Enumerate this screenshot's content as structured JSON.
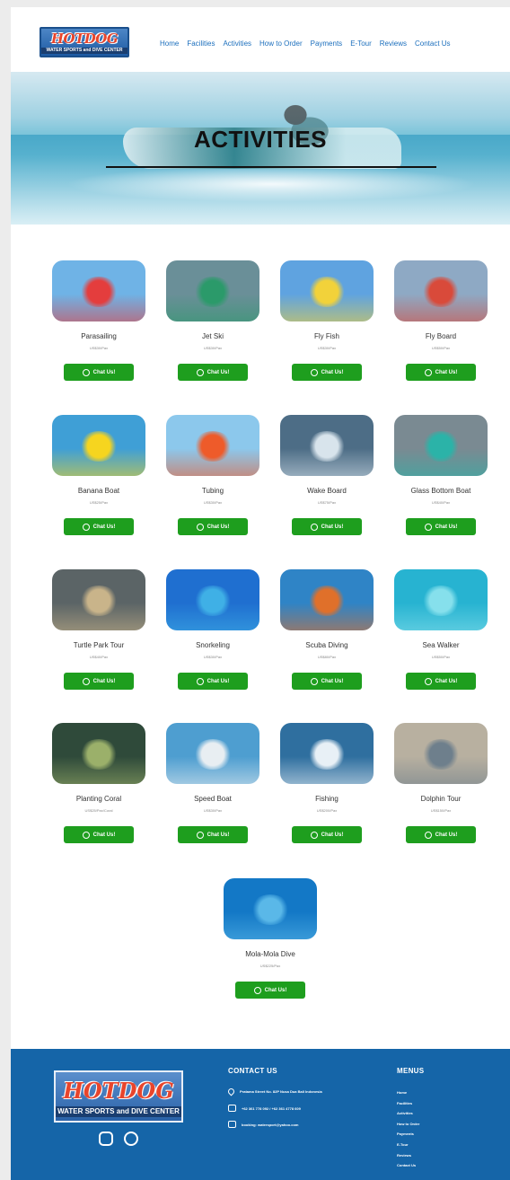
{
  "header": {
    "logo": {
      "title": "HOTDOG",
      "subtitle": "WATER SPORTS and DIVE CENTER"
    },
    "nav": [
      "Home",
      "Facilities",
      "Activities",
      "How to Order",
      "Payments",
      "E-Tour",
      "Reviews",
      "Contact Us"
    ]
  },
  "hero": {
    "title": "ACTIVITIES"
  },
  "activities": [
    {
      "name": "Parasailing",
      "price": "US$30/Pax",
      "button": "Chat Us!",
      "c1": "#6fb3e6",
      "c2": "#e43d3d"
    },
    {
      "name": "Jet Ski",
      "price": "US$30/Pax",
      "button": "Chat Us!",
      "c1": "#6a8f98",
      "c2": "#2b9a6a"
    },
    {
      "name": "Fly Fish",
      "price": "US$30/Pax",
      "button": "Chat Us!",
      "c1": "#5fa3e0",
      "c2": "#f2d23a"
    },
    {
      "name": "Fly Board",
      "price": "US$50/Pax",
      "button": "Chat Us!",
      "c1": "#8ea9c4",
      "c2": "#d94a3a"
    },
    {
      "name": "Banana Boat",
      "price": "US$25/Pax",
      "button": "Chat Us!",
      "c1": "#3f9fd6",
      "c2": "#f6d51f"
    },
    {
      "name": "Tubing",
      "price": "US$30/Pax",
      "button": "Chat Us!",
      "c1": "#8cc8ec",
      "c2": "#ee5b2a"
    },
    {
      "name": "Wake Board",
      "price": "US$75/Pax",
      "button": "Chat Us!",
      "c1": "#4d6d86",
      "c2": "#d8e4ec"
    },
    {
      "name": "Glass Bottom Boat",
      "price": "US$40/Pax",
      "button": "Chat Us!",
      "c1": "#7a8a92",
      "c2": "#2bb3a8"
    },
    {
      "name": "Turtle Park Tour",
      "price": "US$40/Pax",
      "button": "Chat Us!",
      "c1": "#5b6466",
      "c2": "#c9b48a"
    },
    {
      "name": "Snorkeling",
      "price": "US$30/Pax",
      "button": "Chat Us!",
      "c1": "#1f6fd0",
      "c2": "#3fb0e6"
    },
    {
      "name": "Scuba Diving",
      "price": "US$80/Pax",
      "button": "Chat Us!",
      "c1": "#2f84c6",
      "c2": "#e0702a"
    },
    {
      "name": "Sea Walker",
      "price": "US$50/Pax",
      "button": "Chat Us!",
      "c1": "#27b3d1",
      "c2": "#86e0ec"
    },
    {
      "name": "Planting Coral",
      "price": "US$25/Pax/Coral",
      "button": "Chat Us!",
      "c1": "#2f4a3a",
      "c2": "#9bb06a"
    },
    {
      "name": "Speed Boat",
      "price": "US$30/Pax",
      "button": "Chat Us!",
      "c1": "#4e9ed0",
      "c2": "#e8eef2"
    },
    {
      "name": "Fishing",
      "price": "US$200/Pax",
      "button": "Chat Us!",
      "c1": "#2f6f9f",
      "c2": "#e8f0f6"
    },
    {
      "name": "Dolphin Tour",
      "price": "US$150/Pax",
      "button": "Chat Us!",
      "c1": "#b8b0a0",
      "c2": "#6e7f8c"
    },
    {
      "name": "Mola-Mola Dive",
      "price": "US$225/Pax",
      "button": "Chat Us!",
      "c1": "#1378c6",
      "c2": "#5ab8e8"
    }
  ],
  "footer": {
    "logo": {
      "title": "HOTDOG",
      "subtitle": "WATER SPORTS and DIVE CENTER"
    },
    "contact_heading": "CONTACT US",
    "address": "Pratama Street No. 82P Nusa Dua Bali Indonesia",
    "phone": "+62 361 778 092 / +62 361 4778 609",
    "email": "booking: watersport@yahoo.com",
    "menu_heading": "MENUS",
    "menu": [
      "Home",
      "Facilities",
      "Activities",
      "How to Order",
      "Payments",
      "E-Tour",
      "Reviews",
      "Contact Us"
    ]
  }
}
